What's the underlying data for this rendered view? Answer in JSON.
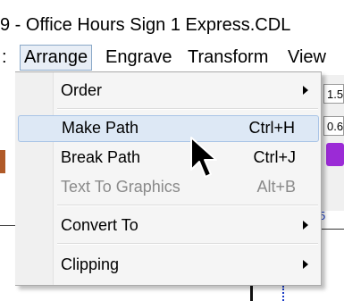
{
  "window": {
    "title": "9 - Office Hours Sign 1 Express.CDL"
  },
  "menubar": {
    "items": [
      {
        "label": ":"
      },
      {
        "label": "Arrange"
      },
      {
        "label": "Engrave"
      },
      {
        "label": "Transform"
      },
      {
        "label": "View"
      }
    ]
  },
  "arrange_menu": {
    "items": [
      {
        "label": "Order",
        "shortcut": "",
        "submenu": true,
        "enabled": true
      },
      {
        "label": "Make Path",
        "shortcut": "Ctrl+H",
        "submenu": false,
        "enabled": true,
        "highlighted": true
      },
      {
        "label": "Break Path",
        "shortcut": "Ctrl+J",
        "submenu": false,
        "enabled": true
      },
      {
        "label": "Text To Graphics",
        "shortcut": "Alt+B",
        "submenu": false,
        "enabled": false
      },
      {
        "label": "Convert To",
        "shortcut": "",
        "submenu": true,
        "enabled": true
      },
      {
        "label": "Clipping",
        "shortcut": "",
        "submenu": true,
        "enabled": true
      }
    ]
  },
  "background": {
    "field_1_value": "1.5",
    "field_2_value": "0.6",
    "ruler_number": "5"
  },
  "colors": {
    "highlight": "#dde8f5",
    "purple_tool": "#9b2bd6"
  }
}
